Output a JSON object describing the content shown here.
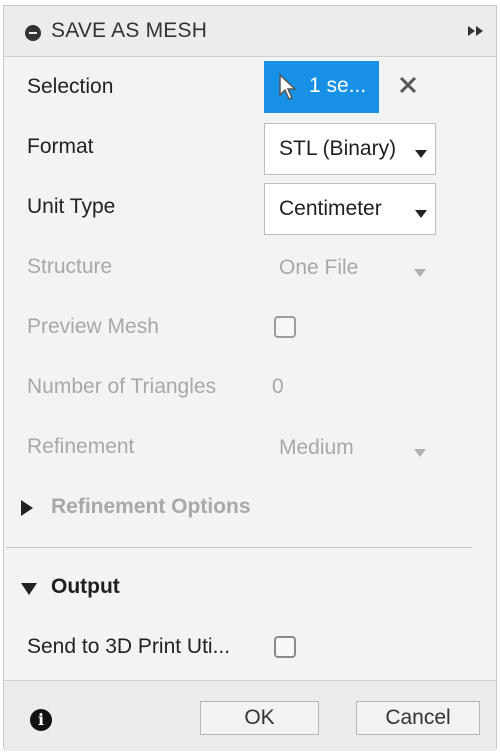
{
  "dialog": {
    "title": "SAVE AS MESH",
    "title_icon": "minus-circle-icon",
    "collapse_icon": "double-chevron-right-icon"
  },
  "fields": {
    "selection": {
      "label": "Selection",
      "button_text": "1 se...",
      "icon": "cursor-icon",
      "clear_icon": "close-icon"
    },
    "format": {
      "label": "Format",
      "value": "STL (Binary)"
    },
    "unit_type": {
      "label": "Unit Type",
      "value": "Centimeter"
    },
    "structure": {
      "label": "Structure",
      "value": "One File"
    },
    "preview_mesh": {
      "label": "Preview Mesh",
      "checked": false
    },
    "num_triangles": {
      "label": "Number of Triangles",
      "value": "0"
    },
    "refinement": {
      "label": "Refinement",
      "value": "Medium"
    }
  },
  "sections": {
    "refinement_options": {
      "label": "Refinement Options",
      "expanded": false
    },
    "output": {
      "label": "Output",
      "expanded": true
    }
  },
  "output": {
    "send_to_3d_print": {
      "label": "Send to 3D Print Uti...",
      "checked": false
    }
  },
  "footer": {
    "info_icon": "info-icon",
    "ok_label": "OK",
    "cancel_label": "Cancel"
  },
  "colors": {
    "accent": "#1791e6",
    "disabled_text": "#a8a8a8"
  }
}
